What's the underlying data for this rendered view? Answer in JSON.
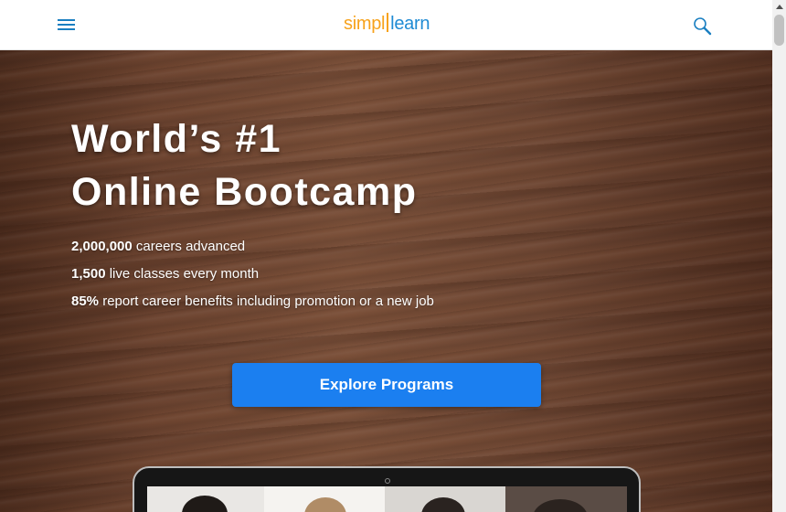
{
  "header": {
    "logo_part1": "simpl",
    "logo_part2": "learn",
    "menu_icon": "hamburger-menu-icon",
    "search_icon": "search-icon"
  },
  "hero": {
    "title_line1": "World’s #1",
    "title_line2": "Online Bootcamp",
    "stats": [
      {
        "value": "2,000,000",
        "text": " careers advanced"
      },
      {
        "value": "1,500",
        "text": " live classes every month"
      },
      {
        "value": "85%",
        "text": " report career benefits including promotion or a new job"
      }
    ],
    "cta_label": "Explore Programs"
  },
  "colors": {
    "brand_orange": "#f7a21b",
    "brand_blue": "#1f8bd4",
    "cta_blue": "#1b7ff0"
  }
}
